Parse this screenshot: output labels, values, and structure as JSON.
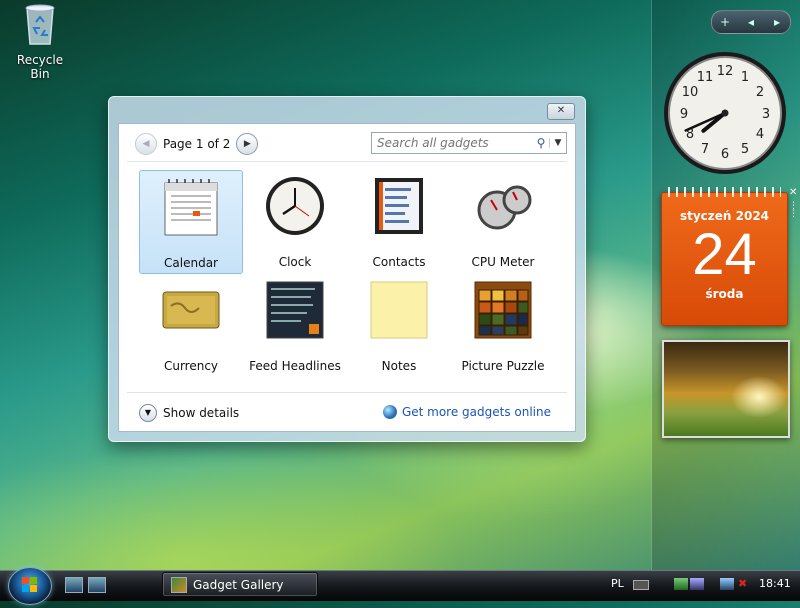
{
  "desktop": {
    "recycle_bin_label": "Recycle Bin"
  },
  "gallery": {
    "pager_text": "Page 1 of 2",
    "search_placeholder": "Search all gadgets",
    "gadgets": [
      {
        "label": "Calendar",
        "selected": true
      },
      {
        "label": "Clock"
      },
      {
        "label": "Contacts"
      },
      {
        "label": "CPU Meter"
      },
      {
        "label": "Currency"
      },
      {
        "label": "Feed Headlines"
      },
      {
        "label": "Notes"
      },
      {
        "label": "Picture Puzzle"
      }
    ],
    "show_details": "Show details",
    "get_more": "Get more gadgets online"
  },
  "calendar_gadget": {
    "month_year": "styczeń 2024",
    "day": "24",
    "weekday": "środa"
  },
  "clock_gadget": {
    "hour": 7,
    "minute": 41
  },
  "taskbar": {
    "task_label": "Gadget Gallery",
    "language": "PL",
    "time": "18:41"
  },
  "colors": {
    "calendar_orange": "#e85a10",
    "link_blue": "#1a55b8",
    "selection": "#c6e2f8"
  }
}
